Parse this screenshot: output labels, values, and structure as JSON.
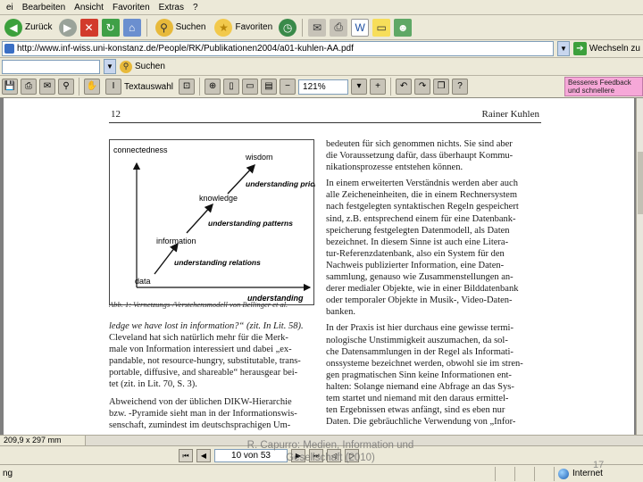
{
  "menubar": {
    "items": [
      "ei",
      "Bearbeiten",
      "Ansicht",
      "Favoriten",
      "Extras",
      "?"
    ]
  },
  "toolbar": {
    "back_label": "Zurück",
    "search_label": "Suchen",
    "favorites_label": "Favoriten"
  },
  "address": {
    "url": "http://www.inf-wiss.uni-konstanz.de/People/RK/Publikationen2004/a01-kuhlen-AA.pdf",
    "go_label": "Wechseln zu"
  },
  "searchbar": {
    "search_label": "Suchen"
  },
  "pdfbar": {
    "select_label": "Textauswahl",
    "zoom": "121%",
    "feedback_text": "Besseres Feedback und schnellere Genehmigung"
  },
  "page": {
    "number": "12",
    "author": "Rainer Kuhlen",
    "caption": "Abb. 1: Vernetzungs-/Verstehensmodell von Bellinger et al.",
    "left_lines": [
      "ledge we have lost in information?“ (zit. In Lit. 58).",
      "Cleveland hat sich natürlich mehr für die Merk-",
      "male von Information interessiert und dabei „ex-",
      "pandable, not resource-hungry, substitutable, trans-",
      "portable, diffusive, and shareable“ herausgear bei-",
      "tet (zit. in Lit. 70, S. 3).",
      "Abweichend von der üblichen DIKW-Hierarchie",
      "bzw. -Pyramide sieht man in der Informationswis-",
      "senschaft, zumindest im deutschsprachigen Um-"
    ],
    "right_lines": [
      "bedeuten für sich genommen nichts. Sie sind aber",
      "die Voraussetzung dafür, dass überhaupt Kommu-",
      "nikationsprozesse entstehen können.",
      "In einem erweiterten Verständnis werden aber auch",
      "alle Zeicheneinheiten, die in einem Rechnersystem",
      "nach festgelegten syntaktischen Regeln gespeichert",
      "sind, z.B. entsprechend einem für eine Datenbank-",
      "speicherung festgelegten Datenmodell, als Daten",
      "bezeichnet. In diesem Sinne ist auch eine Litera-",
      "tur-Referenzdatenbank, also ein System für den",
      "Nachweis publizierter Information, eine Daten-",
      "sammlung, genauso wie Zusammenstellungen an-",
      "derer medialer Objekte, wie in einer Bilddatenbank",
      "oder temporaler Objekte in Musik-, Video-Daten-",
      "banken.",
      "In der Praxis ist hier durchaus eine gewisse termi-",
      "nologische Unstimmigkeit auszumachen, da sol-",
      "che Datensammlungen in der Regel als Informati-",
      "onssysteme bezeichnet werden, obwohl sie im stren-",
      "gen pragmatischen Sinn keine Informationen ent-",
      "halten: Solange niemand eine Abfrage an das Sys-",
      "tem startet und niemand mit den daraus ermittel-",
      "ten Ergebnissen etwas anfängt, sind es eben nur",
      "Daten. Die gebräuchliche Verwendung von „Infor-"
    ]
  },
  "diagram": {
    "y_axis_label": "connectedness",
    "x_axis_label": "understanding",
    "nodes": [
      "data",
      "information",
      "knowledge",
      "wisdom"
    ],
    "transitions": [
      "understanding relations",
      "understanding patterns",
      "understanding priciples"
    ]
  },
  "status": {
    "page_size": "209,9 x 297 mm",
    "page_indicator": "10 von 53",
    "left_text": "ng",
    "zone": "Internet"
  },
  "overlay": {
    "line1": "R. Capurro: Medien, Information und",
    "line2": "Gesellschaft (2010)",
    "slide_number": "17"
  }
}
